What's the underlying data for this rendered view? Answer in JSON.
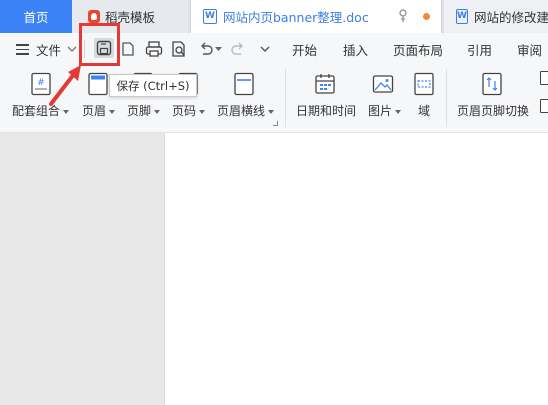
{
  "tabs": {
    "home": "首页",
    "template": "稻壳模板",
    "doc": "网站内页banner整理.doc",
    "doc2": "网站的修改建议"
  },
  "menubar": {
    "file": "文件",
    "items": [
      "开始",
      "插入",
      "页面布局",
      "引用",
      "审阅"
    ]
  },
  "tooltip": "保存 (Ctrl+S)",
  "ribbon": {
    "matching_group": "配套组合",
    "header": "页眉",
    "footer": "页脚",
    "page_number": "页码",
    "header_line": "页眉横线",
    "date_time": "日期和时间",
    "picture": "图片",
    "field": "域",
    "switch_header_footer": "页眉页脚切换"
  },
  "colors": {
    "accent": "#3b82f6",
    "highlight": "#e53935",
    "doc_tab_text": "#3b7fe0",
    "modified_dot": "#f08a3a"
  }
}
